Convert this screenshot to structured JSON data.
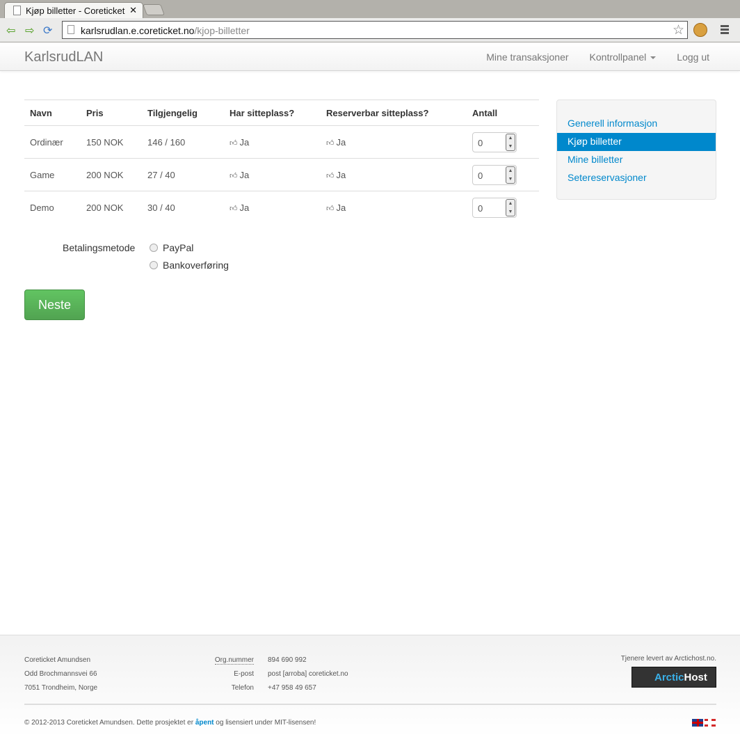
{
  "browser": {
    "tab_title": "Kjøp billetter - Coreticket",
    "url_host": "karlsrudlan.e.coreticket.no",
    "url_path": "/kjop-billetter"
  },
  "navbar": {
    "brand": "KarlsrudLAN",
    "links": [
      "Mine transaksjoner",
      "Kontrollpanel",
      "Logg ut"
    ]
  },
  "table": {
    "headers": [
      "Navn",
      "Pris",
      "Tilgjengelig",
      "Har sitteplass?",
      "Reserverbar sitteplass?",
      "Antall"
    ],
    "rows": [
      {
        "name": "Ordinær",
        "price": "150 NOK",
        "available": "146 / 160",
        "seat": "Ja",
        "reservable": "Ja",
        "qty": "0"
      },
      {
        "name": "Game",
        "price": "200 NOK",
        "available": "27 / 40",
        "seat": "Ja",
        "reservable": "Ja",
        "qty": "0"
      },
      {
        "name": "Demo",
        "price": "200 NOK",
        "available": "30 / 40",
        "seat": "Ja",
        "reservable": "Ja",
        "qty": "0"
      }
    ]
  },
  "payment": {
    "label": "Betalingsmetode",
    "options": [
      "PayPal",
      "Bankoverføring"
    ]
  },
  "next_button": "Neste",
  "sidebar": {
    "items": [
      "Generell informasjon",
      "Kjøp billetter",
      "Mine billetter",
      "Setereservasjoner"
    ]
  },
  "footer": {
    "address": [
      "Coreticket Amundsen",
      "Odd Brochmannsvei 66",
      "7051 Trondheim, Norge"
    ],
    "labels": [
      "Org.nummer",
      "E-post",
      "Telefon"
    ],
    "values": [
      "894 690 992",
      "post [arroba] coreticket.no",
      "+47 958 49 657"
    ],
    "hosting": "Tjenere levert av Arctichost.no.",
    "logo_a": "Arctic",
    "logo_b": "Host",
    "copy_pre": "© 2012-2013 Coreticket Amundsen. Dette prosjektet er ",
    "copy_link": "åpent",
    "copy_post": " og lisensiert under MIT-lisensen!"
  }
}
